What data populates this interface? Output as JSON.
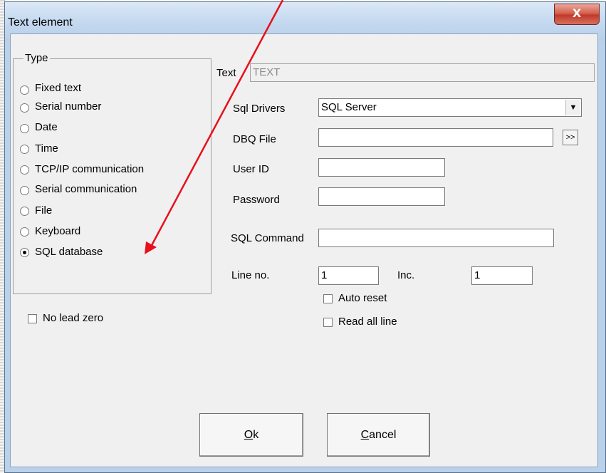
{
  "window": {
    "title": "Text element",
    "close_glyph": "X"
  },
  "type_group": {
    "label": "Type",
    "options": [
      {
        "label": "Fixed text",
        "checked": false
      },
      {
        "label": "Serial number",
        "checked": false
      },
      {
        "label": "Date",
        "checked": false
      },
      {
        "label": "Time",
        "checked": false
      },
      {
        "label": "TCP/IP communication",
        "checked": false
      },
      {
        "label": "Serial communication",
        "checked": false
      },
      {
        "label": "File",
        "checked": false
      },
      {
        "label": "Keyboard",
        "checked": false
      },
      {
        "label": "SQL database",
        "checked": true
      }
    ]
  },
  "no_lead_zero": {
    "label": "No lead zero",
    "checked": false
  },
  "text_field": {
    "label": "Text",
    "value": "TEXT"
  },
  "sql": {
    "drivers_label": "Sql Drivers",
    "drivers_value": "SQL Server",
    "dbq_label": "DBQ File",
    "dbq_value": "",
    "browse_label": ">>",
    "user_label": "User ID",
    "user_value": "",
    "password_label": "Password",
    "password_value": "",
    "command_label": "SQL Command",
    "command_value": "",
    "line_label": "Line no.",
    "line_value": "1",
    "inc_label": "Inc.",
    "inc_value": "1",
    "auto_reset_label": "Auto reset",
    "read_all_label": "Read all line"
  },
  "buttons": {
    "ok_mnemonic": "O",
    "ok_rest": "k",
    "cancel_mnemonic": "C",
    "cancel_rest": "ancel"
  },
  "annotation": {
    "arrow_color": "#e8101a"
  }
}
